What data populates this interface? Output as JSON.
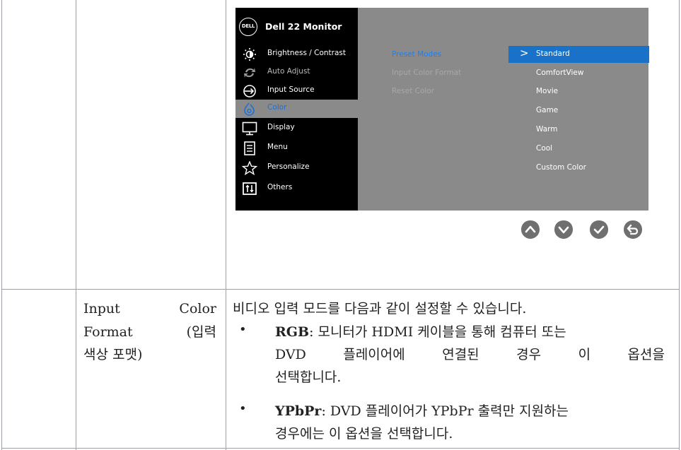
{
  "osd": {
    "logo": "DELL",
    "title": "Dell 22 Monitor",
    "menu": [
      {
        "label": "Brightness / Contrast",
        "icon": "brightness-icon"
      },
      {
        "label": "Auto Adjust",
        "icon": "auto-adjust-icon"
      },
      {
        "label": "Input Source",
        "icon": "input-source-icon"
      },
      {
        "label": "Color",
        "icon": "color-icon"
      },
      {
        "label": "Display",
        "icon": "display-icon"
      },
      {
        "label": "Menu",
        "icon": "menu-icon"
      },
      {
        "label": "Personalize",
        "icon": "personalize-icon"
      },
      {
        "label": "Others",
        "icon": "others-icon"
      }
    ],
    "submenu": [
      "Preset Modes",
      "Input Color Format",
      "Reset Color"
    ],
    "options": [
      "Standard",
      "ComfortView",
      "Movie",
      "Game",
      "Warm",
      "Cool",
      "Custom Color"
    ],
    "selected_caret": ">",
    "nav_buttons": [
      "up-button-icon",
      "down-button-icon",
      "check-button-icon",
      "back-button-icon"
    ],
    "colors": {
      "selection": "#1a72c8",
      "active_text": "#1d7ff0",
      "panel": "#8a8a8a"
    }
  },
  "row2": {
    "name_line1_a": "Input",
    "name_line1_b": "Color",
    "name_line2_a": "Format",
    "name_line2_b": "(입력",
    "name_line3": "색상 포맷)",
    "intro": "비디오 입력 모드를 다음과 같이 설정할 수 있습니다.",
    "bullet_char": "•",
    "rgb_term": "RGB",
    "rgb_line1": ": 모니터가 HDMI 케이블을 통해 컴퓨터 또는",
    "rgb_line2": "DVD 플레이어에 연결된 경우 이 옵션을",
    "rgb_line3": "선택합니다.",
    "ypbpr_term": "YPbPr",
    "ypbpr_line1": ": DVD 플레이어가 YPbPr 출력만 지원하는",
    "ypbpr_line2": "경우에는 이 옵션을 선택합니다."
  }
}
